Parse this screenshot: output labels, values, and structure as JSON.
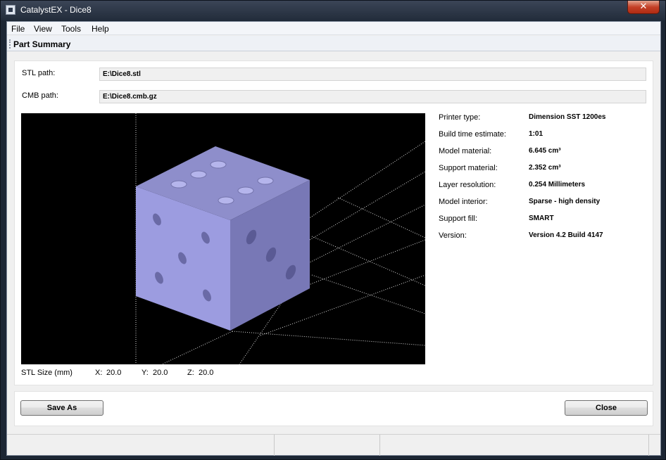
{
  "window": {
    "title": "CatalystEX - Dice8",
    "close_glyph": "✕"
  },
  "menu": {
    "items": [
      "File",
      "View",
      "Tools",
      "Help"
    ]
  },
  "toolstrip": {
    "label": "Part Summary"
  },
  "paths": {
    "stl_label": "STL path:",
    "stl_value": "E:\\Dice8.stl",
    "cmb_label": "CMB path:",
    "cmb_value": "E:\\Dice8.cmb.gz"
  },
  "info": [
    {
      "label": "Printer type:",
      "value": "Dimension SST 1200es"
    },
    {
      "label": "Build time estimate:",
      "value": "1:01"
    },
    {
      "label": "Model material:",
      "value": "6.645 cm³"
    },
    {
      "label": "Support material:",
      "value": "2.352 cm³"
    },
    {
      "label": "Layer resolution:",
      "value": "0.254 Millimeters"
    },
    {
      "label": "Model interior:",
      "value": "Sparse - high density"
    },
    {
      "label": "Support fill:",
      "value": "SMART"
    },
    {
      "label": "Version:",
      "value": "Version 4.2 Build 4147"
    }
  ],
  "stl_size": {
    "label": "STL Size (mm)",
    "x_label": "X:",
    "x": "20.0",
    "y_label": "Y:",
    "y": "20.0",
    "z_label": "Z:",
    "z": "20.0"
  },
  "buttons": {
    "save_as": "Save As",
    "close": "Close"
  },
  "colors": {
    "titlebar": "#222c3b",
    "close_button": "#c44027",
    "die_top": "#8e8ecb",
    "die_left": "#9c9ce0",
    "die_right": "#7878b6"
  },
  "icons": {
    "app": "app-icon",
    "close": "close-icon"
  }
}
